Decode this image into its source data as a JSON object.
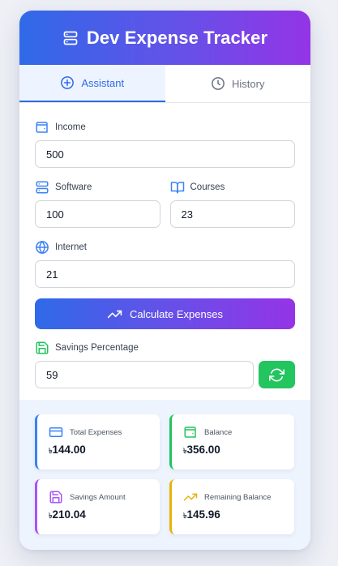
{
  "header": {
    "title": "Dev Expense Tracker",
    "icon": "server-icon"
  },
  "tabs": [
    {
      "label": "Assistant",
      "icon": "plus-circle-icon",
      "active": true
    },
    {
      "label": "History",
      "icon": "clock-icon",
      "active": false
    }
  ],
  "form": {
    "income": {
      "label": "Income",
      "value": "500",
      "icon": "wallet-icon"
    },
    "software": {
      "label": "Software",
      "value": "100",
      "icon": "server-icon"
    },
    "courses": {
      "label": "Courses",
      "value": "23",
      "icon": "book-open-icon"
    },
    "internet": {
      "label": "Internet",
      "value": "21",
      "icon": "globe-icon"
    },
    "calculate_label": "Calculate Expenses",
    "savings": {
      "label": "Savings Percentage",
      "value": "59",
      "icon": "save-icon"
    }
  },
  "results": {
    "currency_symbol": "৳",
    "total_expenses": {
      "label": "Total Expenses",
      "value": "144.00",
      "color": "#3b82f6"
    },
    "balance": {
      "label": "Balance",
      "value": "356.00",
      "color": "#22c55e"
    },
    "savings_amount": {
      "label": "Savings Amount",
      "value": "210.04",
      "color": "#a855f7"
    },
    "remaining_balance": {
      "label": "Remaining Balance",
      "value": "145.96",
      "color": "#eab308"
    }
  },
  "colors": {
    "accent": "#2f6ae8",
    "gradient_end": "#9434e6",
    "success": "#22c55e"
  }
}
